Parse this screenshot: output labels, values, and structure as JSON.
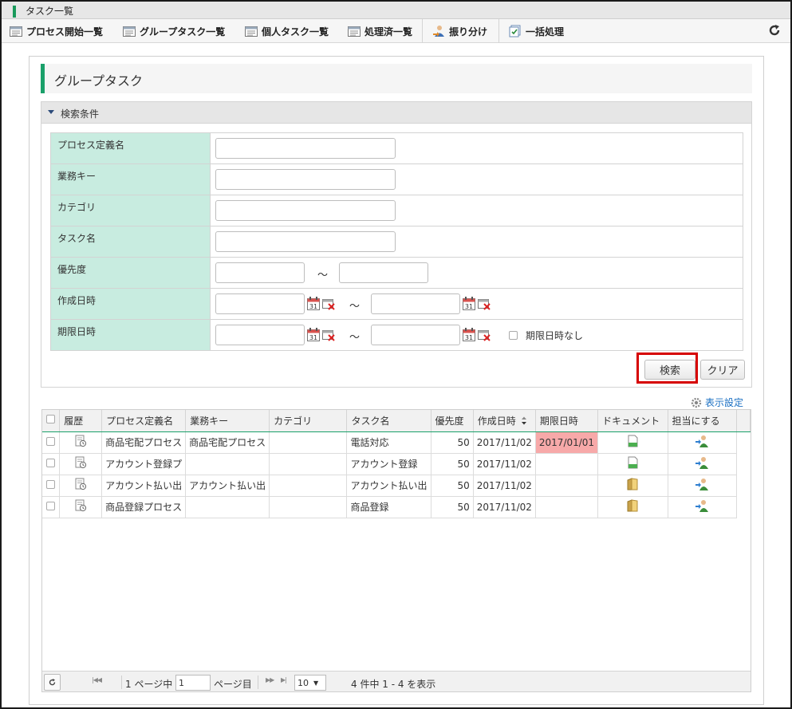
{
  "window": {
    "title": "タスク一覧"
  },
  "toolbar": {
    "items": [
      {
        "label": "プロセス開始一覧",
        "icon": "list-icon"
      },
      {
        "label": "グループタスク一覧",
        "icon": "list-icon"
      },
      {
        "label": "個人タスク一覧",
        "icon": "list-icon"
      },
      {
        "label": "処理済一覧",
        "icon": "list-icon"
      },
      {
        "label": "振り分け",
        "icon": "user-assign-icon"
      },
      {
        "label": "一括処理",
        "icon": "batch-icon"
      }
    ],
    "reload_icon": "reload-icon"
  },
  "page": {
    "title": "グループタスク"
  },
  "search": {
    "header": "検索条件",
    "fields": {
      "process_def": {
        "label": "プロセス定義名",
        "value": ""
      },
      "business_key": {
        "label": "業務キー",
        "value": ""
      },
      "category": {
        "label": "カテゴリ",
        "value": ""
      },
      "task_name": {
        "label": "タスク名",
        "value": ""
      },
      "priority": {
        "label": "優先度",
        "from": "",
        "to": ""
      },
      "created": {
        "label": "作成日時",
        "from": "",
        "to": ""
      },
      "due": {
        "label": "期限日時",
        "from": "",
        "to": "",
        "no_due_label": "期限日時なし"
      }
    },
    "tilde": "～",
    "search_button": "検索",
    "clear_button": "クリア"
  },
  "display_settings": "表示設定",
  "grid": {
    "columns": [
      "履歴",
      "プロセス定義名",
      "業務キー",
      "カテゴリ",
      "タスク名",
      "優先度",
      "作成日時",
      "期限日時",
      "ドキュメント",
      "担当にする"
    ],
    "rows": [
      {
        "process": "商品宅配プロセス",
        "business_key": "商品宅配プロセス",
        "category": "",
        "task": "電話対応",
        "priority": "50",
        "created": "2017/11/02",
        "due": "2017/01/01",
        "doc_icon": "document-green-icon"
      },
      {
        "process": "アカウント登録プ",
        "business_key": "",
        "category": "",
        "task": "アカウント登録",
        "priority": "50",
        "created": "2017/11/02",
        "due": "",
        "doc_icon": "document-green-icon"
      },
      {
        "process": "アカウント払い出",
        "business_key": "アカウント払い出",
        "category": "",
        "task": "アカウント払い出",
        "priority": "50",
        "created": "2017/11/02",
        "due": "",
        "doc_icon": "folder-icon"
      },
      {
        "process": "商品登録プロセス",
        "business_key": "",
        "category": "",
        "task": "商品登録",
        "priority": "50",
        "created": "2017/11/02",
        "due": "",
        "doc_icon": "folder-icon"
      }
    ],
    "due_highlight_color": "#f7a9a9"
  },
  "pager": {
    "page_prefix": "1 ページ中",
    "page_value": "1",
    "page_suffix": "ページ目",
    "per_page": "10",
    "summary": "4 件中 1 - 4 を表示"
  },
  "colors": {
    "accent": "#1aa06a",
    "label_bg": "#c8ece0",
    "highlight": "#d60000"
  }
}
